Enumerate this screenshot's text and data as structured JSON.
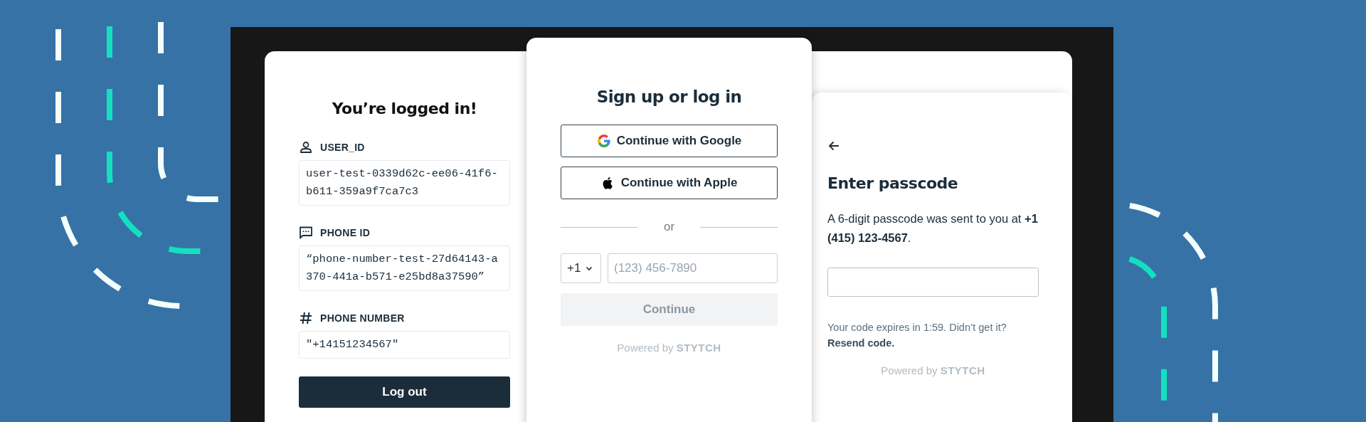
{
  "logged_in_card": {
    "title": "You’re logged in!",
    "fields": [
      {
        "label": "USER_ID",
        "value": "user-test-0339d62c-ee06-41f6-b611-359a9f7ca7c3"
      },
      {
        "label": "PHONE ID",
        "value": "“phone-number-test-27d64143-a370-441a-b571-e25bd8a37590”"
      },
      {
        "label": "PHONE NUMBER",
        "value": "\"+14151234567\""
      }
    ],
    "button": "Log out"
  },
  "login_card": {
    "title": "Sign up or log in",
    "oauth_buttons": [
      {
        "label": "Continue with Google",
        "kind": "google"
      },
      {
        "label": "Continue with Apple",
        "kind": "apple"
      }
    ],
    "divider": "or",
    "country_code": "+1",
    "phone_field": {
      "placeholder": "(123) 456-7890"
    },
    "continue_button": {
      "label": "Continue",
      "disabled": true
    },
    "powered_by": "Powered by",
    "brand": "STYTCH"
  },
  "passcode_card": {
    "title": "Enter passcode",
    "message": "A 6-digit passcode was sent to you at **+1 (415) 123-4567**.",
    "expiry_text": "Your code expires in 1:59. Didn’t get it?",
    "resend_link": "Resend code.",
    "powered_by": "Powered by",
    "brand": "STYTCH"
  }
}
